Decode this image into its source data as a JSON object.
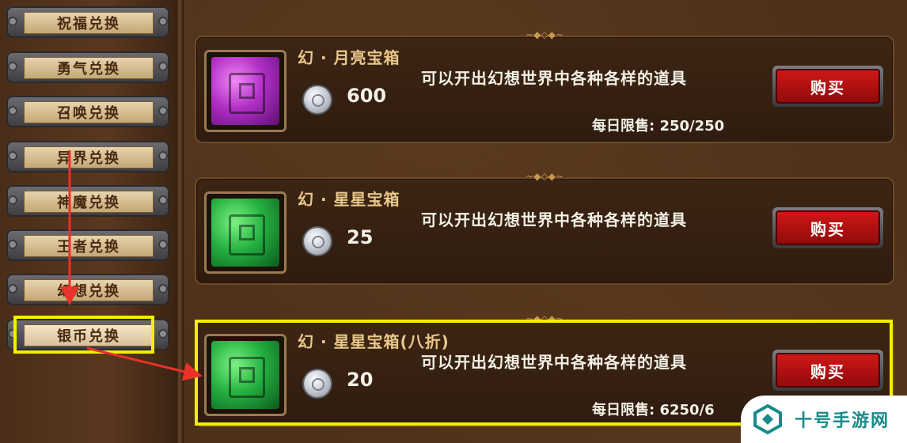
{
  "sidebar": {
    "tabs": [
      {
        "label": "祝福兑换"
      },
      {
        "label": "勇气兑换"
      },
      {
        "label": "召唤兑换"
      },
      {
        "label": "异界兑换"
      },
      {
        "label": "神魔兑换"
      },
      {
        "label": "王者兑换"
      },
      {
        "label": "幻想兑换"
      },
      {
        "label": "银币兑换",
        "selected": true
      }
    ]
  },
  "items": [
    {
      "name": "幻 · 月亮宝箱",
      "icon": "purple-chest-icon",
      "currency_icon": "silver-coin-icon",
      "price": "600",
      "description": "可以开出幻想世界中各种各样的道具",
      "limit": "每日限售: 250/250",
      "buy_label": "购买"
    },
    {
      "name": "幻 · 星星宝箱",
      "icon": "green-chest-icon",
      "currency_icon": "silver-coin-icon",
      "price": "25",
      "description": "可以开出幻想世界中各种各样的道具",
      "limit": "",
      "buy_label": "购买"
    },
    {
      "name": "幻 · 星星宝箱(八折)",
      "icon": "green-chest-icon",
      "currency_icon": "silver-coin-icon",
      "price": "20",
      "description": "可以开出幻想世界中各种各样的道具",
      "limit": "每日限售: 6250/6",
      "buy_label": "购买"
    }
  ],
  "watermark": {
    "text": "十号手游网"
  },
  "colors": {
    "highlight": "#f4ef00",
    "arrow": "#e8322a",
    "buy_button": "#c01414"
  }
}
